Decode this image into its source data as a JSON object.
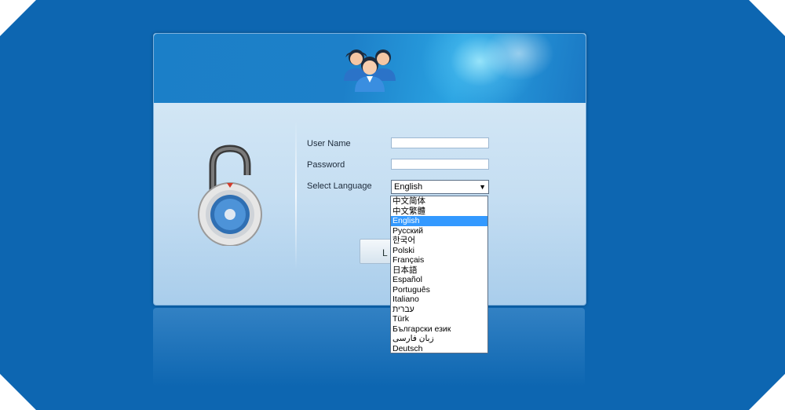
{
  "form": {
    "username_label": "User Name",
    "password_label": "Password",
    "language_label": "Select Language",
    "username_value": "",
    "password_value": "",
    "selected_language": "English",
    "login_button": "L"
  },
  "languages": [
    "中文简体",
    "中文繁體",
    "English",
    "Русский",
    "한국어",
    "Polski",
    "Français",
    "日本語",
    "Español",
    "Português",
    "Italiano",
    "עברית",
    "Türk",
    "Български език",
    "زبان فارسی",
    "Deutsch"
  ],
  "icons": {
    "banner": "users-group-icon",
    "lock": "padlock-icon",
    "dropdown": "caret-down-icon"
  },
  "colors": {
    "background": "#0d66b1",
    "selection": "#3399ff"
  }
}
